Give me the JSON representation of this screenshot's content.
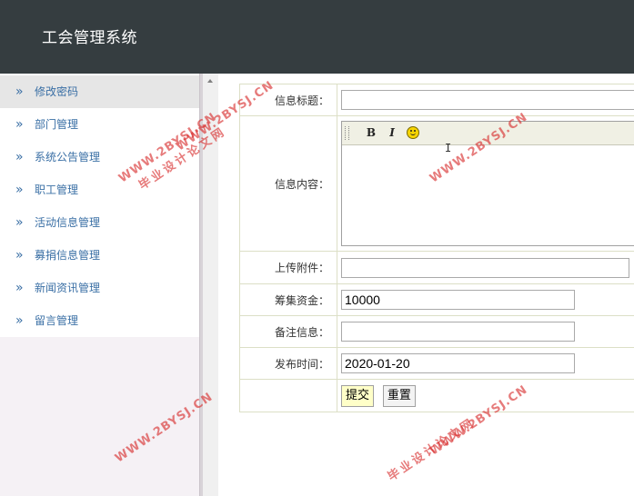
{
  "app": {
    "title": "工会管理系统"
  },
  "sidebar": {
    "arrow_glyph": "»",
    "items": [
      {
        "label": "修改密码",
        "active": true
      },
      {
        "label": "部门管理"
      },
      {
        "label": "系统公告管理"
      },
      {
        "label": "职工管理"
      },
      {
        "label": "活动信息管理"
      },
      {
        "label": "募捐信息管理"
      },
      {
        "label": "新闻资讯管理"
      },
      {
        "label": "留言管理"
      }
    ]
  },
  "form": {
    "title_label": "信息标题：",
    "title_value": "",
    "content_label": "信息内容：",
    "editor": {
      "bold": "B",
      "italic": "I",
      "emoticon": "smiley-icon"
    },
    "attachment_label": "上传附件：",
    "attachment_value": "",
    "fund_label": "筹集资金：",
    "fund_value": "10000",
    "remark_label": "备注信息：",
    "remark_value": "",
    "date_label": "发布时间：",
    "date_value": "2020-01-20",
    "submit_label": "提交",
    "reset_label": "重置"
  },
  "watermark": {
    "url": "WWW.2BYSJ.CN",
    "site": "毕业设计论文网",
    "color": "#d62828"
  }
}
